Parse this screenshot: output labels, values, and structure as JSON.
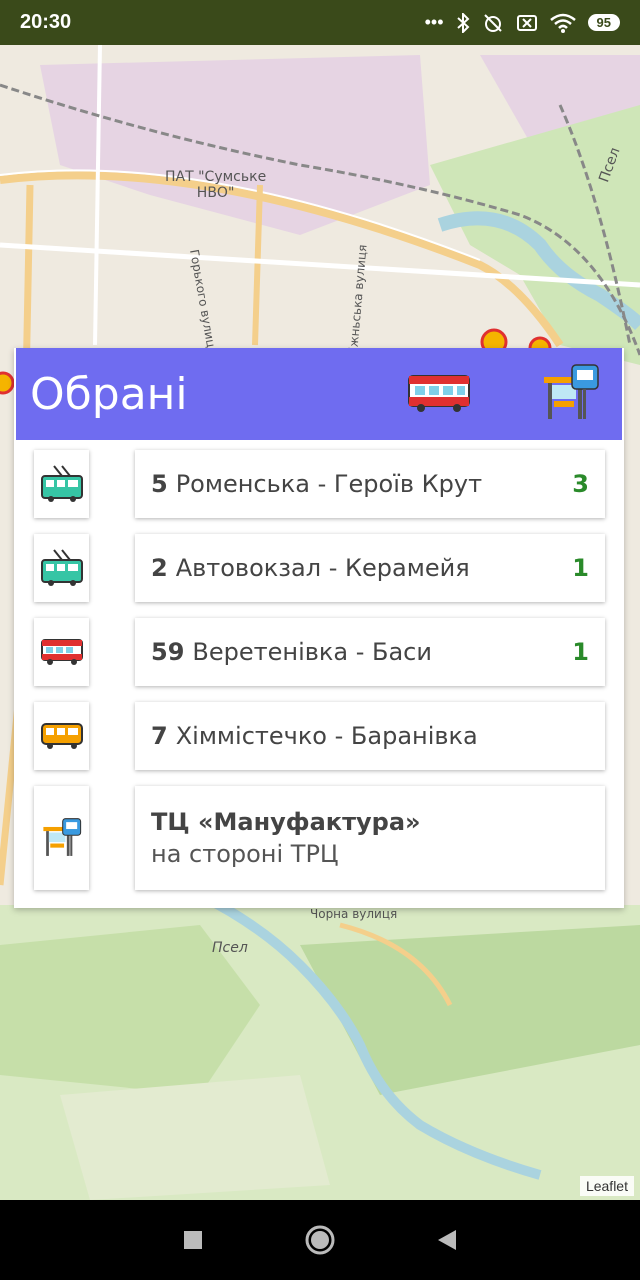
{
  "status": {
    "time": "20:30",
    "battery": "95"
  },
  "map": {
    "labels": {
      "plant": "ПАТ \"Сумське\nНВО\"",
      "river_top": "Псел",
      "river_bottom": "Псел",
      "street_gorkogo": "Горького вулиця",
      "street_nizhnya": "Ніжньська вулиця",
      "street_bottom": "Чорна вулиця"
    },
    "attribution": "Leaflet"
  },
  "favorites": {
    "title": "Обрані",
    "header_buttons": [
      "bus-icon",
      "bus-stop-icon"
    ],
    "routes": [
      {
        "icon": "trolleybus-icon",
        "number": "5",
        "name": "Роменська - Героїв Крут",
        "count": "3"
      },
      {
        "icon": "trolleybus-icon",
        "number": "2",
        "name": "Автовокзал - Керамейя",
        "count": "1"
      },
      {
        "icon": "bus-icon",
        "number": "59",
        "name": "Веретенівка - Баси",
        "count": "1"
      },
      {
        "icon": "minibus-icon",
        "number": "7",
        "name": "Хіммістечко - Баранівка",
        "count": ""
      }
    ],
    "stops": [
      {
        "icon": "bus-stop-icon",
        "name": "ТЦ «Мануфактура»",
        "side": "на стороні ТРЦ"
      }
    ]
  },
  "colors": {
    "header": "#6f6cf0",
    "count": "#2a8a2a",
    "statusbar": "#3a4a1a"
  }
}
